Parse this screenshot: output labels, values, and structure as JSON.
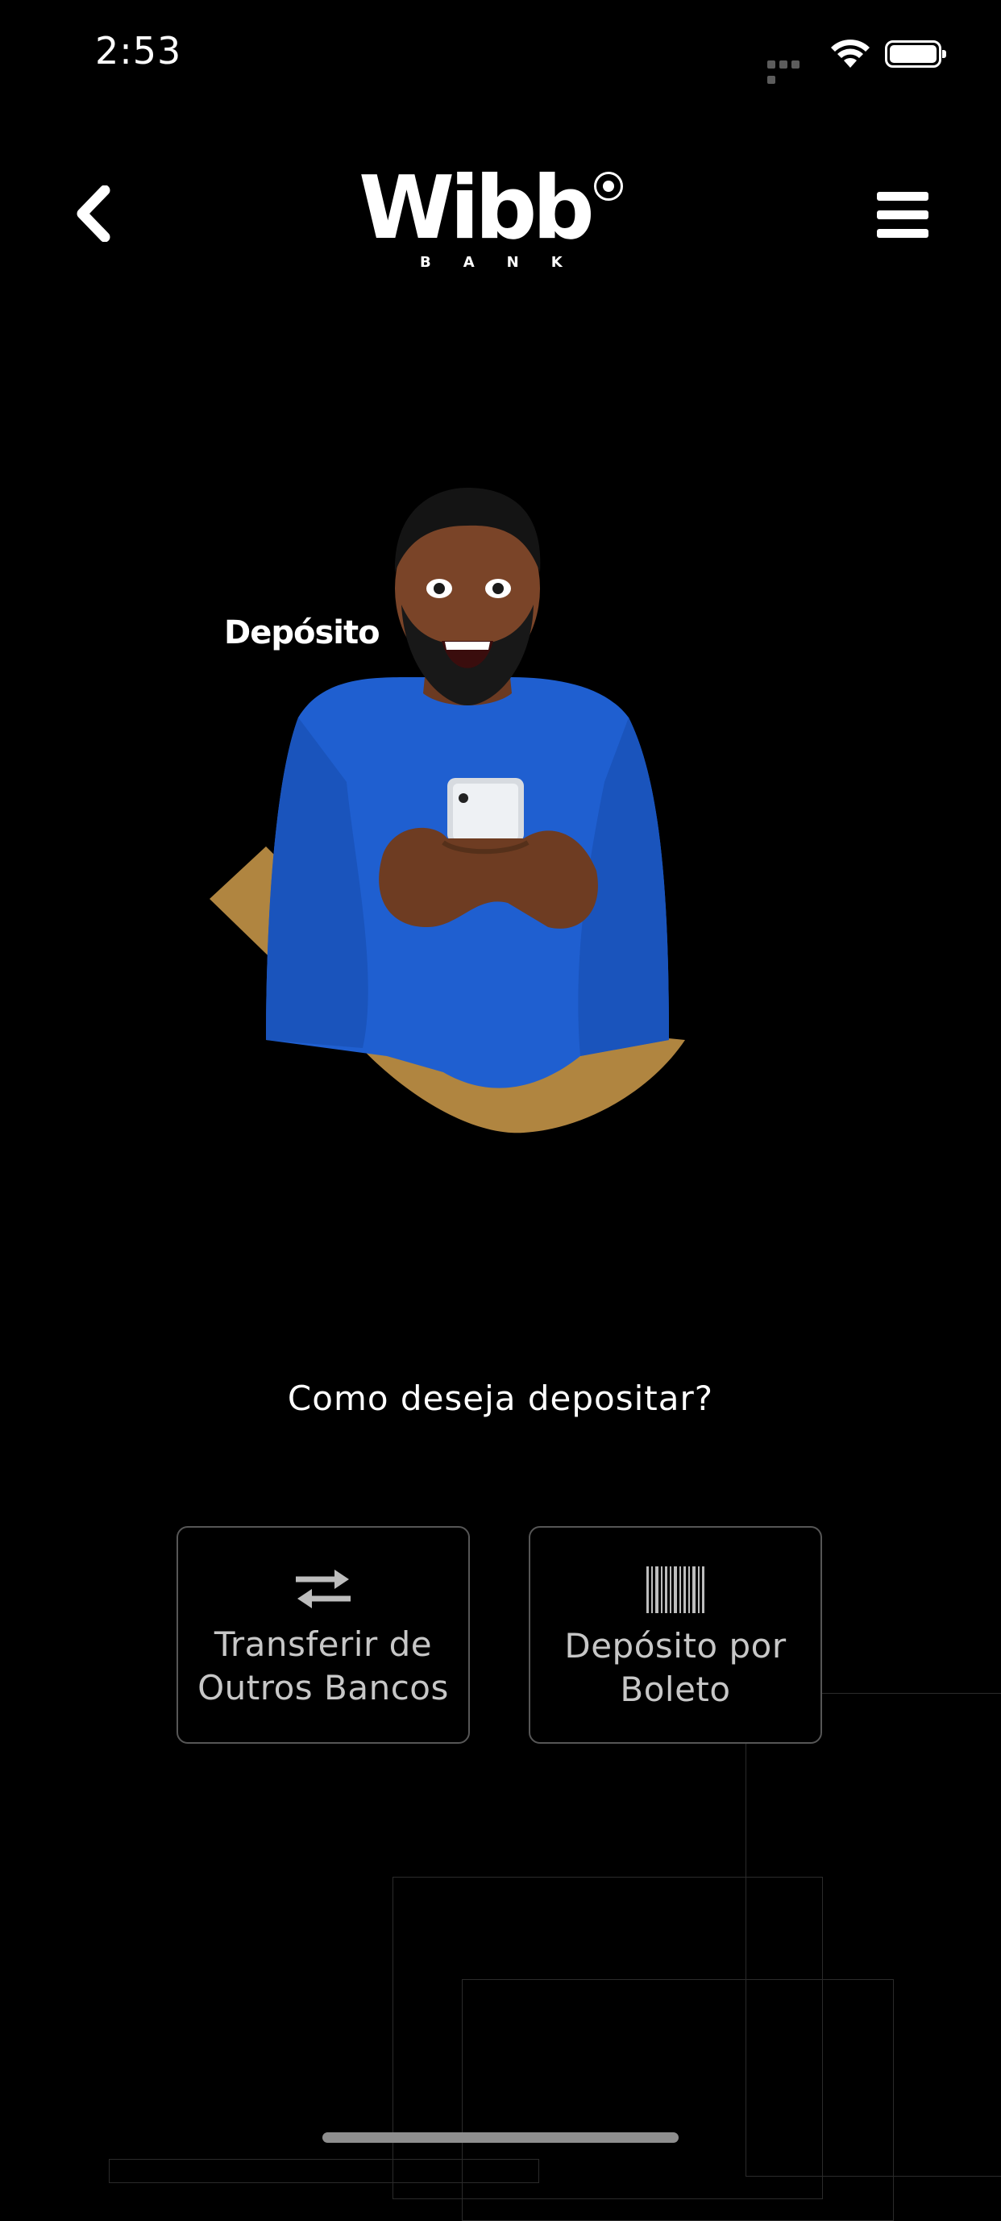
{
  "status_bar": {
    "time": "2:53"
  },
  "header": {
    "logo_text": "Wibb",
    "logo_sub": "BANK"
  },
  "hero": {
    "label": "Depósito"
  },
  "main": {
    "question": "Como deseja depositar?",
    "options": [
      {
        "icon": "transfer-arrows-icon",
        "label_line1": "Transferir de",
        "label_line2": "Outros Bancos"
      },
      {
        "icon": "barcode-icon",
        "label_line1": "Depósito por",
        "label_line2": "Boleto"
      }
    ]
  },
  "colors": {
    "background": "#000000",
    "accent_gold": "#B08540",
    "shirt_blue": "#1F5FD0",
    "card_border": "#565656"
  }
}
